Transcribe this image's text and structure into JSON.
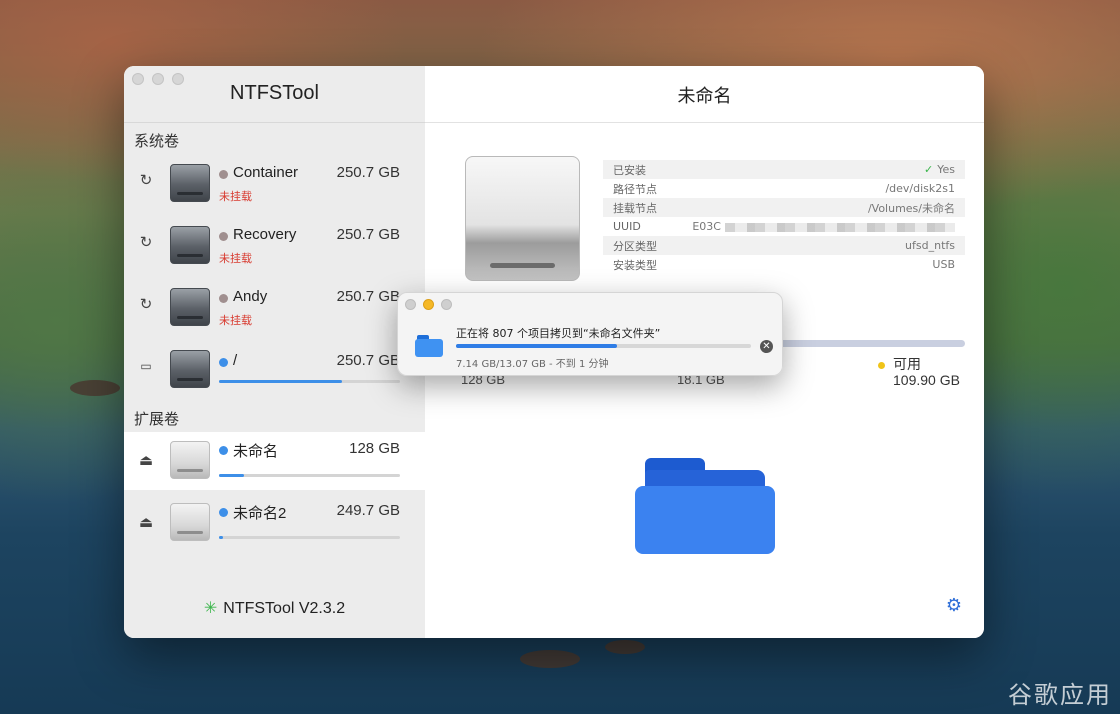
{
  "app": {
    "title": "NTFSTool",
    "version": "NTFSTool V2.3.2"
  },
  "sidebar": {
    "system_section": "系统卷",
    "external_section": "扩展卷",
    "volumes": [
      {
        "name": "Container",
        "size": "250.7 GB",
        "state": "未挂载",
        "dot_color": "#a08f8f",
        "icon": "refresh-icon",
        "usage_fraction": null
      },
      {
        "name": "Recovery",
        "size": "250.7 GB",
        "state": "未挂载",
        "dot_color": "#a08f8f",
        "icon": "refresh-icon",
        "usage_fraction": null
      },
      {
        "name": "Andy",
        "size": "250.7 GB",
        "state": "未挂载",
        "dot_color": "#a08f8f",
        "icon": "refresh-icon",
        "usage_fraction": null
      },
      {
        "name": "/",
        "size": "250.7 GB",
        "state": "",
        "dot_color": "#3d8fe8",
        "icon": "drive-icon",
        "usage_fraction": 0.68
      }
    ],
    "external": [
      {
        "name": "未命名",
        "size": "128 GB",
        "usage_fraction": 0.14,
        "icon": "eject-icon"
      },
      {
        "name": "未命名2",
        "size": "249.7 GB",
        "usage_fraction": 0.02,
        "icon": "eject-icon"
      }
    ]
  },
  "main": {
    "title": "未命名",
    "info": [
      {
        "label": "已安装",
        "value": "Yes"
      },
      {
        "label": "路径节点",
        "value": "/dev/disk2s1"
      },
      {
        "label": "挂载节点",
        "value": "/Volumes/未命名"
      },
      {
        "label": "UUID",
        "value": "E03C"
      },
      {
        "label": "分区类型",
        "value": "ufsd_ntfs"
      },
      {
        "label": "安装类型",
        "value": "USB"
      }
    ],
    "usage": {
      "total": "128 GB",
      "used": "18.1 GB",
      "available_label": "可用",
      "available": "109.90 GB",
      "available_color": "#f0c419"
    }
  },
  "dialog": {
    "message": "正在将 807 个项目拷贝到“未命名文件夹”",
    "progress_text": "7.14 GB/13.07 GB - 不到 1 分钟",
    "progress_fraction": 0.546
  },
  "watermark": "谷歌应用"
}
